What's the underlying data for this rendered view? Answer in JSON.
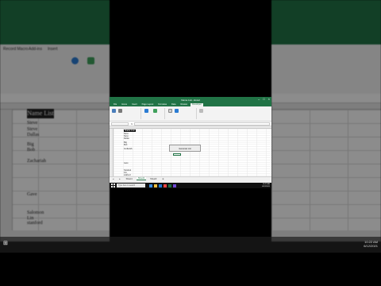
{
  "window": {
    "title": "Name List - Excel"
  },
  "ribbon": {
    "tabs": [
      "File",
      "Home",
      "Insert",
      "Page Layout",
      "Formulas",
      "Data",
      "Review",
      "Developer"
    ]
  },
  "formula": {
    "fx_label": "fx"
  },
  "sheet": {
    "title": "Name List",
    "button_label": "Generate List"
  },
  "names": [
    "Steve",
    "Steve",
    "Dallas",
    "Big",
    "Bob",
    "Zachariah",
    "Gave",
    "Salomon",
    "Lin",
    "stanford"
  ],
  "sheets": [
    "Sheet1",
    "Sheet2",
    "Sheet3"
  ],
  "bg": {
    "title": "Name List",
    "ribbon_left": [
      "Record Macro",
      "Add-ins",
      "Insert"
    ]
  },
  "taskbar": {
    "search_placeholder": "Type here to search",
    "time": "10:22 AM",
    "date": "6/12/2021"
  },
  "colors": {
    "excel_green": "#217346",
    "taskbar": "#101010"
  }
}
